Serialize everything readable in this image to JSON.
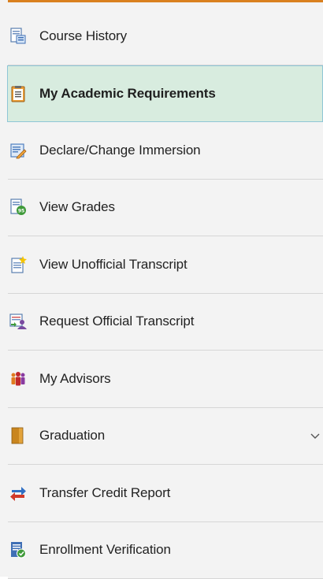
{
  "nav": {
    "items": [
      {
        "label": "Course History",
        "icon": "course-history-icon",
        "active": false
      },
      {
        "label": "My Academic Requirements",
        "icon": "academic-requirements-icon",
        "active": true
      },
      {
        "label": "Declare/Change Immersion",
        "icon": "declare-change-icon",
        "active": false
      },
      {
        "label": "View Grades",
        "icon": "view-grades-icon",
        "active": false
      },
      {
        "label": "View Unofficial Transcript",
        "icon": "unofficial-transcript-icon",
        "active": false
      },
      {
        "label": "Request Official Transcript",
        "icon": "official-transcript-icon",
        "active": false
      },
      {
        "label": "My Advisors",
        "icon": "advisors-icon",
        "active": false
      },
      {
        "label": "Graduation",
        "icon": "graduation-folder-icon",
        "active": false,
        "expandable": true
      },
      {
        "label": "Transfer Credit Report",
        "icon": "transfer-arrows-icon",
        "active": false
      },
      {
        "label": "Enrollment Verification",
        "icon": "enrollment-verification-icon",
        "active": false
      }
    ]
  },
  "colors": {
    "accent_top": "#d9801f",
    "nav_bg": "#f3f3f3",
    "active_bg": "#d8ecdf",
    "active_border": "#8ec6d6"
  }
}
